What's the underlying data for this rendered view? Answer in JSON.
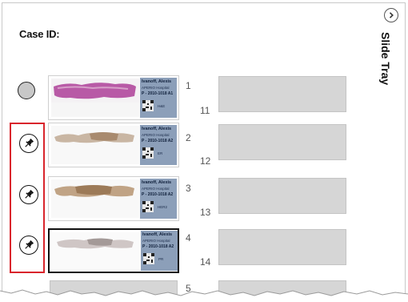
{
  "header": {
    "case_id_label": "Case ID:"
  },
  "tray": {
    "title": "Slide Tray",
    "toggle_icon": "chevron-right-icon"
  },
  "status": {
    "icon": "status-circle-icon"
  },
  "pins": [
    {
      "icon": "pin-icon"
    },
    {
      "icon": "pin-icon"
    },
    {
      "icon": "pin-icon"
    }
  ],
  "slides": [
    {
      "number": "1",
      "label": {
        "name": "Ivanoff, Alexis",
        "hospital": "APERIO Hospital",
        "case": "P - 2010-1018 A1",
        "stain": "H&E"
      },
      "tissue_color": "#b85aa6",
      "selected": false
    },
    {
      "number": "2",
      "label": {
        "name": "Ivanoff, Alexis",
        "hospital": "APERIO Hospital",
        "case": "P - 2010-1018 A2",
        "stain": "ER"
      },
      "tissue_color": "#a88a6e",
      "selected": false
    },
    {
      "number": "3",
      "label": {
        "name": "Ivanoff, Alexis",
        "hospital": "APERIO Hospital",
        "case": "P - 2010-1018 A2",
        "stain": "HER2"
      },
      "tissue_color": "#9c7a58",
      "selected": false
    },
    {
      "number": "4",
      "label": {
        "name": "Ivanoff, Alexis",
        "hospital": "APERIO Hospital",
        "case": "P - 2010-1018 A2",
        "stain": "PR"
      },
      "tissue_color": "#a49a98",
      "selected": true
    }
  ],
  "empty_slots_right": [
    "11",
    "12",
    "13",
    "14"
  ],
  "empty_slots_left": [
    "5"
  ],
  "colors": {
    "highlight": "#d9252c",
    "label_panel": "#8c9fb9",
    "empty_slot": "#d6d6d6"
  }
}
